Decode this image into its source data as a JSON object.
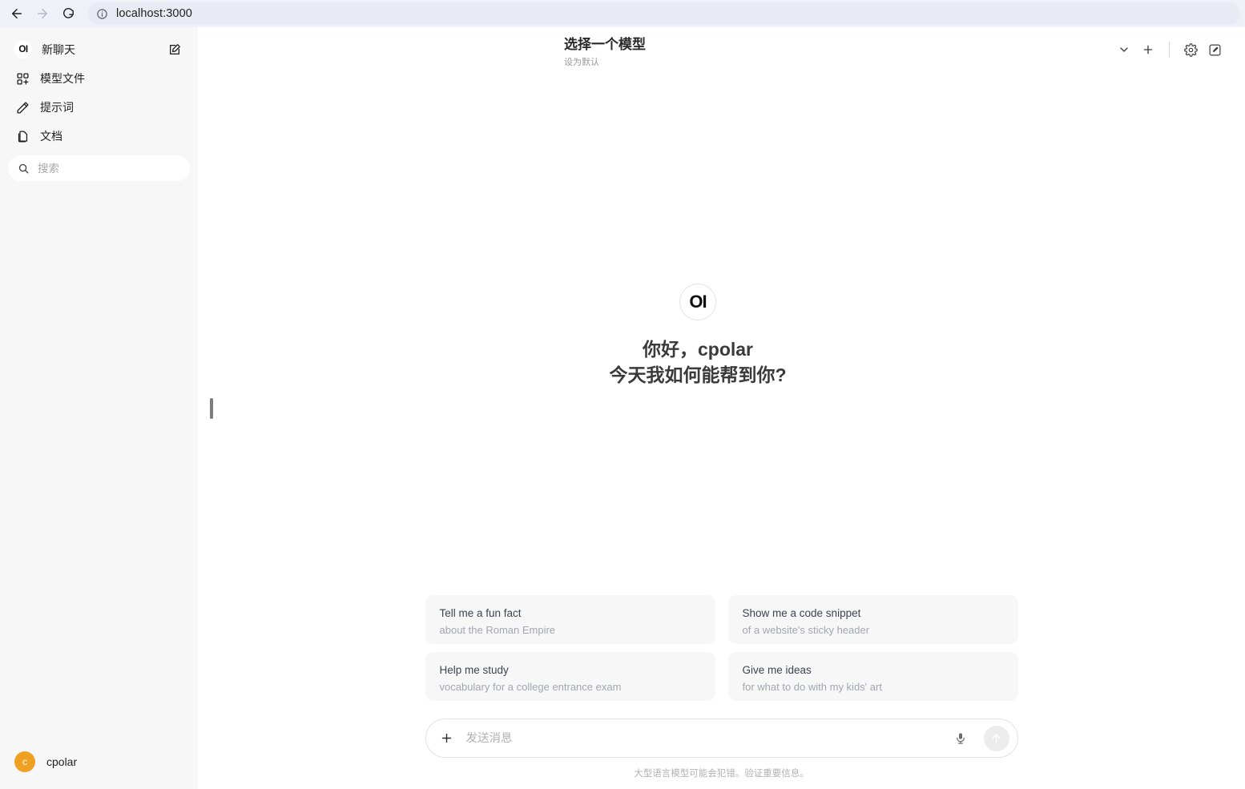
{
  "browser": {
    "back_label": "back-arrow",
    "forward_label": "forward-arrow",
    "reload_label": "reload",
    "site_info_label": "site-info",
    "url": "localhost:3000"
  },
  "sidebar": {
    "brand": "OI",
    "new_chat_label": "新聊天",
    "compose_label": "compose",
    "items": [
      {
        "label": "模型文件",
        "icon": "grid-plus-icon"
      },
      {
        "label": "提示词",
        "icon": "pencil-icon"
      },
      {
        "label": "文档",
        "icon": "documents-icon"
      }
    ],
    "search": {
      "placeholder": "搜索",
      "value": ""
    },
    "user": {
      "avatar_initial": "c",
      "avatar_color": "#f0a020",
      "name": "cpolar"
    }
  },
  "header": {
    "model_title": "选择一个模型",
    "model_subtitle": "设为默认",
    "actions": [
      {
        "name": "chevron-down-icon"
      },
      {
        "name": "plus-icon"
      },
      {
        "name": "gear-icon"
      },
      {
        "name": "compose-icon"
      }
    ]
  },
  "greeting": {
    "logo": "OI",
    "line1": "你好，cpolar",
    "line2": "今天我如何能帮到你?"
  },
  "suggestions": [
    {
      "title": "Tell me a fun fact",
      "subtitle": "about the Roman Empire"
    },
    {
      "title": "Show me a code snippet",
      "subtitle": "of a website's sticky header"
    },
    {
      "title": "Help me study",
      "subtitle": "vocabulary for a college entrance exam"
    },
    {
      "title": "Give me ideas",
      "subtitle": "for what to do with my kids' art"
    }
  ],
  "composer": {
    "attach_label": "plus-icon",
    "placeholder": "发送消息",
    "value": "",
    "mic_label": "microphone-icon",
    "send_label": "send-icon"
  },
  "disclaimer": "大型语言模型可能会犯错。验证重要信息。"
}
